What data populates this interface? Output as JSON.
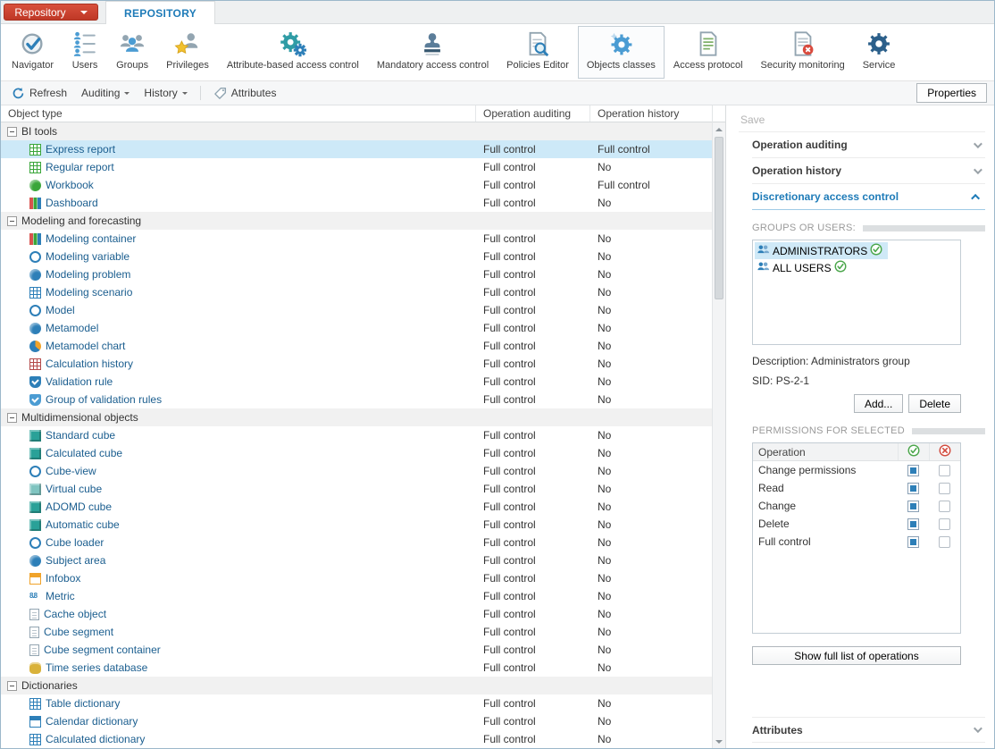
{
  "tabbar": {
    "app_button": "Repository",
    "tab": "REPOSITORY"
  },
  "ribbon": {
    "items": [
      {
        "name": "navigator",
        "label": "Navigator",
        "selected": false
      },
      {
        "name": "users",
        "label": "Users",
        "selected": false
      },
      {
        "name": "groups",
        "label": "Groups",
        "selected": false
      },
      {
        "name": "privileges",
        "label": "Privileges",
        "selected": false
      },
      {
        "name": "attribute-based-access-control",
        "label": "Attribute-based access control",
        "selected": false
      },
      {
        "name": "mandatory-access-control",
        "label": "Mandatory access control",
        "selected": false
      },
      {
        "name": "policies-editor",
        "label": "Policies Editor",
        "selected": false
      },
      {
        "name": "objects-classes",
        "label": "Objects classes",
        "selected": true
      },
      {
        "name": "access-protocol",
        "label": "Access protocol",
        "selected": false
      },
      {
        "name": "security-monitoring",
        "label": "Security monitoring",
        "selected": false
      },
      {
        "name": "service",
        "label": "Service",
        "selected": false
      }
    ]
  },
  "toolbar": {
    "refresh": "Refresh",
    "auditing": "Auditing",
    "history": "History",
    "attributes": "Attributes",
    "properties": "Properties"
  },
  "table": {
    "columns": [
      "Object type",
      "Operation auditing",
      "Operation history"
    ],
    "rows": [
      {
        "group": true,
        "label": "BI tools"
      },
      {
        "label": "Express report",
        "icon": "express-report-icon",
        "kind": "grid",
        "color": "#3aa63a",
        "auditing": "Full control",
        "history": "Full control",
        "selected": true
      },
      {
        "label": "Regular report",
        "icon": "regular-report-icon",
        "kind": "grid",
        "color": "#3aa63a",
        "auditing": "Full control",
        "history": "No"
      },
      {
        "label": "Workbook",
        "icon": "workbook-icon",
        "kind": "dot",
        "color": "#3aa63a",
        "auditing": "Full control",
        "history": "Full control"
      },
      {
        "label": "Dashboard",
        "icon": "dashboard-icon",
        "kind": "bars",
        "color": "#2aa198",
        "auditing": "Full control",
        "history": "No"
      },
      {
        "group": true,
        "label": "Modeling and forecasting"
      },
      {
        "label": "Modeling container",
        "icon": "modeling-container-icon",
        "kind": "bars",
        "color": "#2d7fb8",
        "auditing": "Full control",
        "history": "No"
      },
      {
        "label": "Modeling variable",
        "icon": "modeling-variable-icon",
        "kind": "ring",
        "color": "#2d7fb8",
        "auditing": "Full control",
        "history": "No"
      },
      {
        "label": "Modeling problem",
        "icon": "modeling-problem-icon",
        "kind": "dot",
        "color": "#2d7fb8",
        "auditing": "Full control",
        "history": "No"
      },
      {
        "label": "Modeling scenario",
        "icon": "modeling-scenario-icon",
        "kind": "grid",
        "color": "#2d7fb8",
        "auditing": "Full control",
        "history": "No"
      },
      {
        "label": "Model",
        "icon": "model-icon",
        "kind": "ring",
        "color": "#2d7fb8",
        "auditing": "Full control",
        "history": "No"
      },
      {
        "label": "Metamodel",
        "icon": "metamodel-icon",
        "kind": "dot",
        "color": "#2d7fb8",
        "auditing": "Full control",
        "history": "No"
      },
      {
        "label": "Metamodel chart",
        "icon": "metamodel-chart-icon",
        "kind": "pie",
        "color": "#2d7fb8",
        "auditing": "Full control",
        "history": "No"
      },
      {
        "label": "Calculation history",
        "icon": "calculation-history-icon",
        "kind": "grid",
        "color": "#b44b4b",
        "auditing": "Full control",
        "history": "No"
      },
      {
        "label": "Validation rule",
        "icon": "validation-rule-icon",
        "kind": "shield",
        "color": "#2d7fb8",
        "auditing": "Full control",
        "history": "No"
      },
      {
        "label": "Group of validation rules",
        "icon": "group-of-validation-rules-icon",
        "kind": "shield",
        "color": "#4b9cd3",
        "auditing": "Full control",
        "history": "No"
      },
      {
        "group": true,
        "label": "Multidimensional objects"
      },
      {
        "label": "Standard cube",
        "icon": "standard-cube-icon",
        "kind": "cube",
        "color": "#2aa198",
        "auditing": "Full control",
        "history": "No"
      },
      {
        "label": "Calculated cube",
        "icon": "calculated-cube-icon",
        "kind": "cube",
        "color": "#2aa198",
        "auditing": "Full control",
        "history": "No"
      },
      {
        "label": "Cube-view",
        "icon": "cube-view-icon",
        "kind": "ring",
        "color": "#2d7fb8",
        "auditing": "Full control",
        "history": "No"
      },
      {
        "label": "Virtual cube",
        "icon": "virtual-cube-icon",
        "kind": "cube",
        "color": "#7fc4c0",
        "auditing": "Full control",
        "history": "No"
      },
      {
        "label": "ADOMD cube",
        "icon": "adomd-cube-icon",
        "kind": "cube",
        "color": "#2aa198",
        "auditing": "Full control",
        "history": "No"
      },
      {
        "label": "Automatic cube",
        "icon": "automatic-cube-icon",
        "kind": "cube",
        "color": "#2aa198",
        "auditing": "Full control",
        "history": "No"
      },
      {
        "label": "Cube loader",
        "icon": "cube-loader-icon",
        "kind": "ring",
        "color": "#2d7fb8",
        "auditing": "Full control",
        "history": "No"
      },
      {
        "label": "Subject area",
        "icon": "subject-area-icon",
        "kind": "dot",
        "color": "#2d7fb8",
        "auditing": "Full control",
        "history": "No"
      },
      {
        "label": "Infobox",
        "icon": "infobox-icon",
        "kind": "calendar",
        "color": "#f0a32a",
        "auditing": "Full control",
        "history": "No"
      },
      {
        "label": "Metric",
        "icon": "metric-icon",
        "kind": "digits",
        "color": "#2d7fb8",
        "auditing": "Full control",
        "history": "No"
      },
      {
        "label": "Cache object",
        "icon": "cache-object-icon",
        "kind": "doc",
        "color": "#93a5b1",
        "auditing": "Full control",
        "history": "No"
      },
      {
        "label": "Cube segment",
        "icon": "cube-segment-icon",
        "kind": "doc",
        "color": "#93a5b1",
        "auditing": "Full control",
        "history": "No"
      },
      {
        "label": "Cube segment container",
        "icon": "cube-segment-container-icon",
        "kind": "doc",
        "color": "#93a5b1",
        "auditing": "Full control",
        "history": "No"
      },
      {
        "label": "Time series database",
        "icon": "time-series-database-icon",
        "kind": "db",
        "color": "#d9b23a",
        "auditing": "Full control",
        "history": "No"
      },
      {
        "group": true,
        "label": "Dictionaries"
      },
      {
        "label": "Table dictionary",
        "icon": "table-dictionary-icon",
        "kind": "grid",
        "color": "#2d7fb8",
        "auditing": "Full control",
        "history": "No"
      },
      {
        "label": "Calendar dictionary",
        "icon": "calendar-dictionary-icon",
        "kind": "calendar",
        "color": "#2d7fb8",
        "auditing": "Full control",
        "history": "No"
      },
      {
        "label": "Calculated dictionary",
        "icon": "calculated-dictionary-icon",
        "kind": "grid",
        "color": "#2d7fb8",
        "auditing": "Full control",
        "history": "No"
      }
    ]
  },
  "panel": {
    "save_label": "Save",
    "section_auditing": "Operation auditing",
    "section_history": "Operation history",
    "section_dac": "Discretionary access control",
    "section_attributes": "Attributes",
    "groups_users_label": "GROUPS OR USERS:",
    "groups": [
      {
        "label": "ADMINISTRATORS",
        "selected": true
      },
      {
        "label": "ALL USERS",
        "selected": false
      }
    ],
    "description_label": "Description:",
    "description_value": "Administrators group",
    "sid_label": "SID:",
    "sid_value": "PS-2-1",
    "add_button": "Add...",
    "delete_button": "Delete",
    "permissions_label": "PERMISSIONS FOR SELECTED",
    "operation_column": "Operation",
    "permissions": [
      {
        "label": "Change permissions",
        "allow": true,
        "deny": false
      },
      {
        "label": "Read",
        "allow": true,
        "deny": false
      },
      {
        "label": "Change",
        "allow": true,
        "deny": false
      },
      {
        "label": "Delete",
        "allow": true,
        "deny": false
      },
      {
        "label": "Full control",
        "allow": true,
        "deny": false
      }
    ],
    "show_full_button": "Show full list of operations"
  }
}
